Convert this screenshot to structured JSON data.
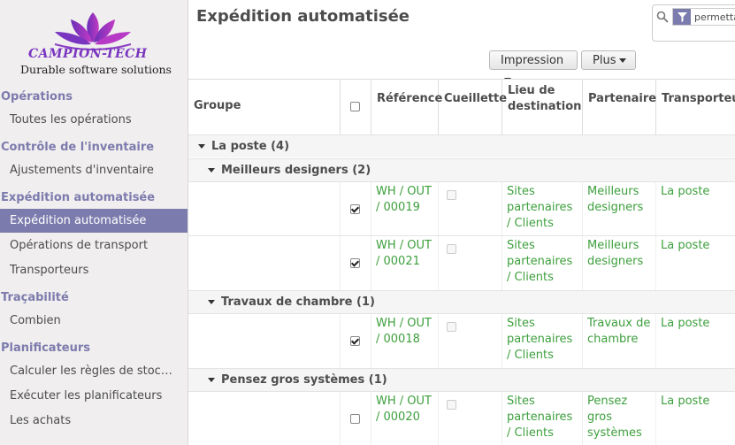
{
  "logo": {
    "brand": "CAMPION-TECH",
    "tagline": "Durable software solutions"
  },
  "sidebar": {
    "sections": [
      {
        "title": "Opérations",
        "items": [
          "Toutes les opérations"
        ]
      },
      {
        "title": "Contrôle de l'inventaire",
        "items": [
          "Ajustements d'inventaire"
        ]
      },
      {
        "title": "Expédition automatisée",
        "items": [
          "Expédition automatisée",
          "Opérations de transport",
          "Transporteurs"
        ]
      },
      {
        "title": "Traçabilité",
        "items": [
          "Combien"
        ]
      },
      {
        "title": "Planificateurs",
        "items": [
          "Calculer les règles de stoc…",
          "Exécuter les planificateurs",
          "Les achats"
        ]
      }
    ],
    "active_item": "Expédition automatisée"
  },
  "header": {
    "title": "Expédition automatisée",
    "filter_text": "permettant",
    "print_button": "Impression",
    "more_button": "Plus"
  },
  "table": {
    "columns": {
      "group": "Groupe",
      "reference": "Référence",
      "picking": "Cueillette",
      "destination": "Lieu de destination",
      "partner": "Partenaire",
      "carrier": "Transporteur"
    },
    "groups": [
      {
        "label": "La poste (4)"
      },
      {
        "label": "Meilleurs designers (2)"
      },
      {
        "label": "Travaux de chambre (1)"
      },
      {
        "label": "Pensez gros systèmes (1)"
      }
    ],
    "rows": [
      {
        "reference": "WH / OUT / 00019",
        "destination": "Sites partenaires / Clients",
        "partner": "Meilleurs designers",
        "carrier": "La poste",
        "checked": true
      },
      {
        "reference": "WH / OUT / 00021",
        "destination": "Sites partenaires / Clients",
        "partner": "Meilleurs designers",
        "carrier": "La poste",
        "checked": true
      },
      {
        "reference": "WH / OUT / 00018",
        "destination": "Sites partenaires / Clients",
        "partner": "Travaux de chambre",
        "carrier": "La poste",
        "checked": true
      },
      {
        "reference": "WH / OUT / 00020",
        "destination": "Sites partenaires / Clients",
        "partner": "Pensez gros systèmes",
        "carrier": "La poste",
        "checked": false
      }
    ]
  },
  "colors": {
    "accent": "#7c7bad",
    "link_green": "#3d9f3d",
    "sidebar_bg": "#f0eeee"
  }
}
